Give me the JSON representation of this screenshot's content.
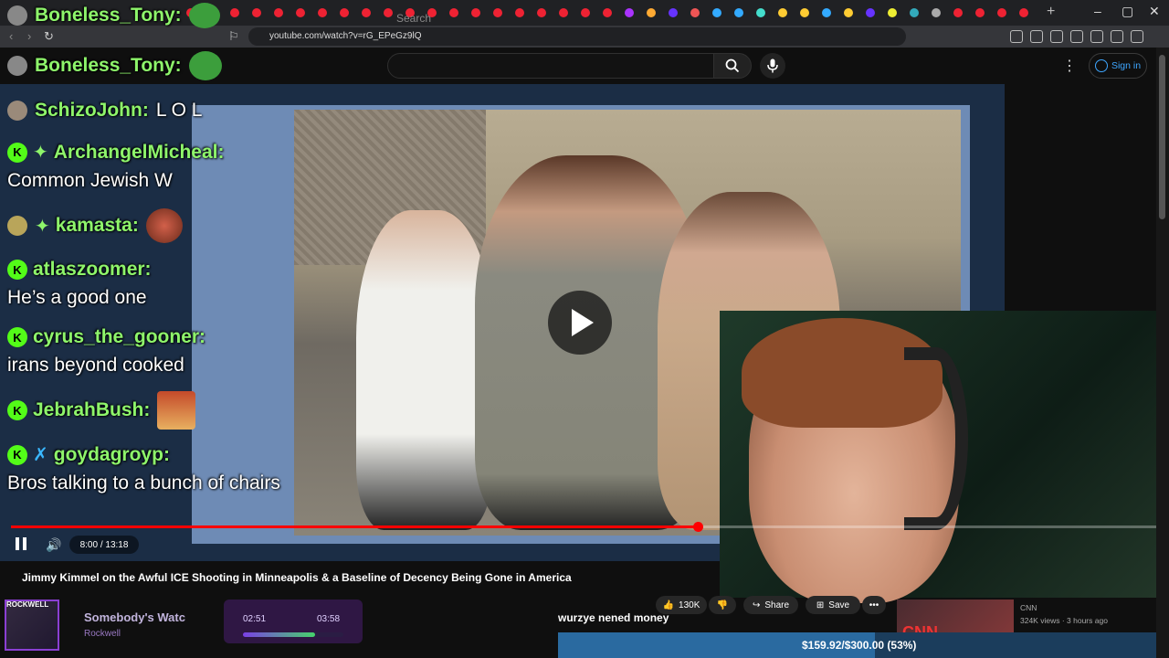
{
  "browser": {
    "url": "youtube.com/watch?v=rG_EPeGz9lQ"
  },
  "header": {
    "search_placeholder": "Search",
    "sign_in": "Sign in"
  },
  "chat": [
    {
      "name": "Boneless_Tony:",
      "message": ""
    },
    {
      "name": "Boneless_Tony:",
      "message": ""
    },
    {
      "name": "SchizoJohn:",
      "message": "L O L"
    },
    {
      "name": "ArchangelMicheal:",
      "message": "Common Jewish W"
    },
    {
      "name": "kamasta:",
      "message": ""
    },
    {
      "name": "atlaszoomer:",
      "message": "He’s a good one"
    },
    {
      "name": "cyrus_the_gooner:",
      "message": "irans beyond cooked"
    },
    {
      "name": "JebrahBush:",
      "message": ""
    },
    {
      "name": "goydagroyp:",
      "message": "Bros talking to a bunch of chairs"
    }
  ],
  "player": {
    "time": "8:00 / 13:18",
    "progress_fraction": 0.6
  },
  "video": {
    "title": "Jimmy Kimmel on the Awful ICE Shooting in Minneapolis & a Baseline of Decency Being Gone in America",
    "likes": "130K",
    "share": "Share",
    "save": "Save"
  },
  "recommended": {
    "channel": "CNN",
    "meta": "324K views · 3 hours ago",
    "thumb_label": "CNN"
  },
  "now_playing": {
    "art_label": "ROCKWELL",
    "title": "Somebody's Watc",
    "artist": "Rockwell",
    "elapsed": "02:51",
    "total": "03:58",
    "progress_fraction": 0.72
  },
  "overlay": {
    "ticker": "wurzye nened money",
    "goal_text": "$159.92/$300.00 (53%)",
    "goal_fraction": 0.53
  },
  "colors": {
    "chat_name": "#8ef56b",
    "kick_green": "#53fc18",
    "yt_red": "#ff0000",
    "link_blue": "#3ea6ff"
  }
}
